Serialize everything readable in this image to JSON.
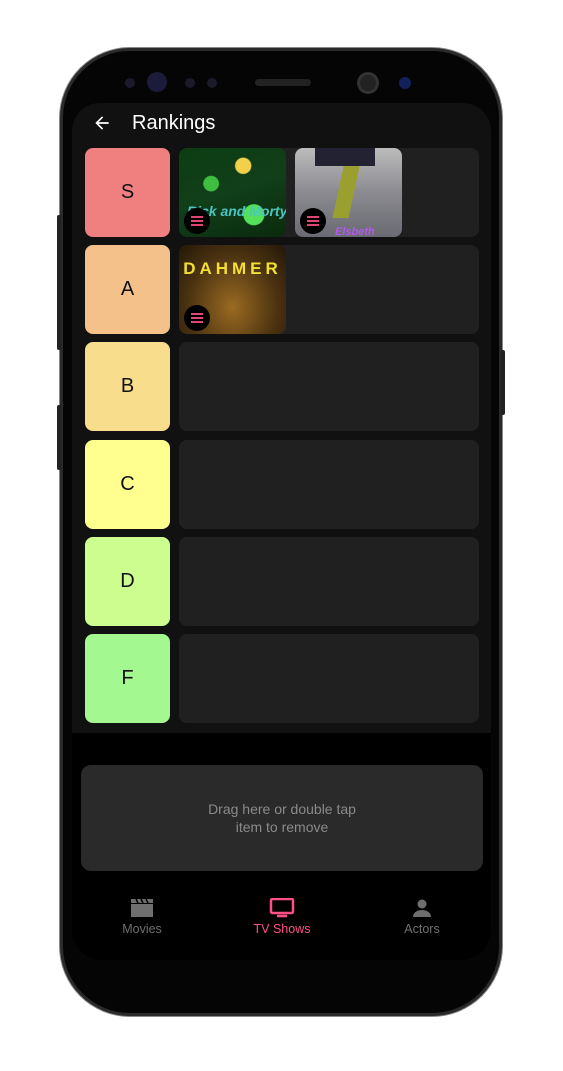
{
  "header": {
    "title": "Rankings"
  },
  "tiers": [
    {
      "label": "S",
      "color": "#f08080",
      "items": [
        {
          "title": "Rick and Morty"
        },
        {
          "title": "Elsbeth"
        }
      ]
    },
    {
      "label": "A",
      "color": "#f5c18a",
      "items": [
        {
          "title": "DAHMER"
        }
      ]
    },
    {
      "label": "B",
      "color": "#f8dd8d",
      "items": []
    },
    {
      "label": "C",
      "color": "#ffff8f",
      "items": []
    },
    {
      "label": "D",
      "color": "#cdfc8f",
      "items": []
    },
    {
      "label": "F",
      "color": "#a3f990",
      "items": []
    }
  ],
  "dropzone": {
    "line1": "Drag here or double tap",
    "line2": "item to remove"
  },
  "nav": {
    "items": [
      {
        "label": "Movies"
      },
      {
        "label": "TV Shows",
        "active": true
      },
      {
        "label": "Actors"
      }
    ],
    "accent": "#ff4f86"
  }
}
